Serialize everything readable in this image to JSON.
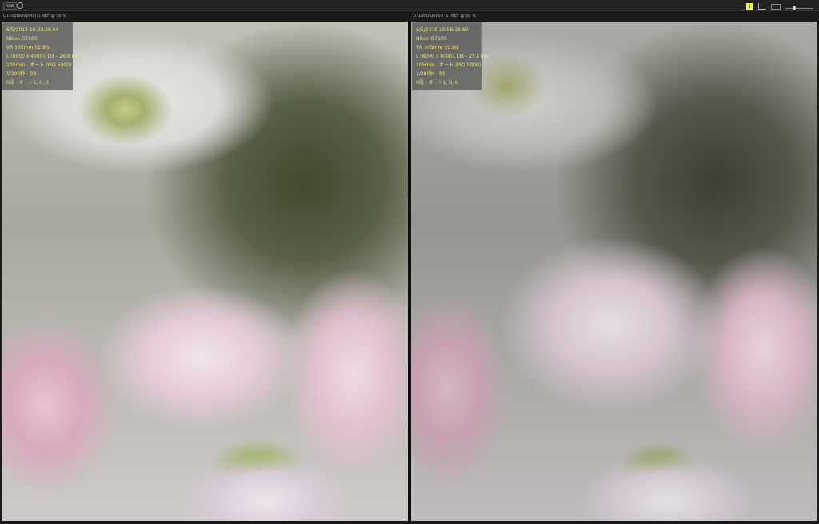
{
  "toolbar": {
    "raw_label": "RAW",
    "info_label": "i"
  },
  "panels": [
    {
      "filename": "D7200ISO5000 (1).NEF @ 50 %",
      "info": [
        "6/5/2015 16:03:28.04",
        "Nikon D7200",
        "VR 105mm f/2.8G",
        "L (6000 x 4000), DX - 26.8 MB",
        "105mm - オート (ISO 5000)",
        "1/200秒 - f/8",
        "0段 - オート1, 0, 0"
      ]
    },
    {
      "filename": "D7100ISO5000 (1).NEF @ 50 %",
      "info": [
        "6/5/2015 15:58:18.60",
        "Nikon D7100",
        "VR 105mm f/2.8G",
        "L (6000 x 4000), DX - 27.1 MB",
        "105mm - オート (ISO 5000)",
        "1/200秒 - f/8",
        "0段 - オート1, 0, 0"
      ]
    }
  ],
  "colors": {
    "info_text": "#e8e080",
    "info_button": "#e9f560"
  }
}
